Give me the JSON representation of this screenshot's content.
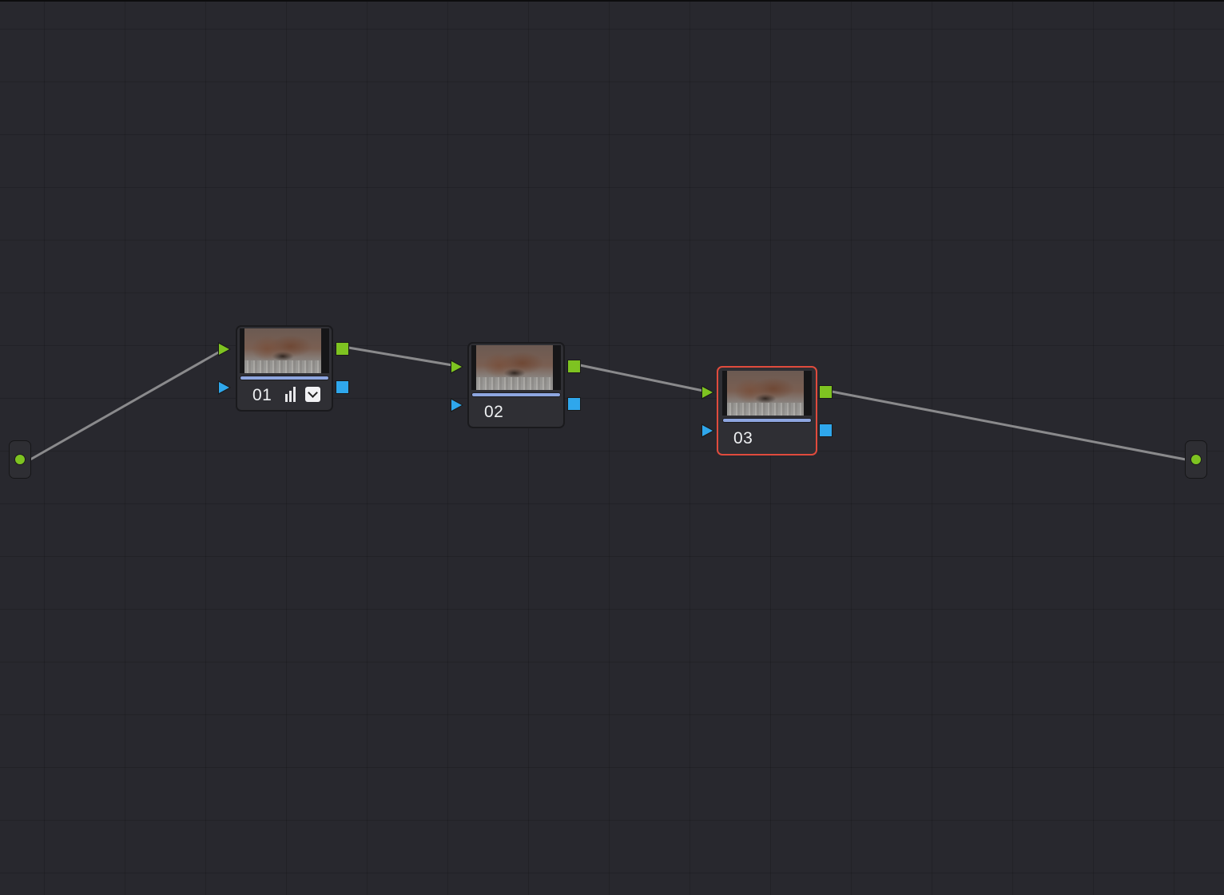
{
  "editor": {
    "nodes": [
      {
        "label": "01",
        "selected": false,
        "icons": [
          "histogram-icon",
          "checkbox-icon"
        ]
      },
      {
        "label": "02",
        "selected": false,
        "icons": []
      },
      {
        "label": "03",
        "selected": true,
        "icons": []
      }
    ],
    "colors": {
      "background": "#28282e",
      "rgb_port": "#7ec321",
      "alpha_port": "#2fa7ec",
      "selected_outline": "#e04b3d",
      "node_bar": "#8ea6e0",
      "connection": "#8a8a8c"
    }
  }
}
